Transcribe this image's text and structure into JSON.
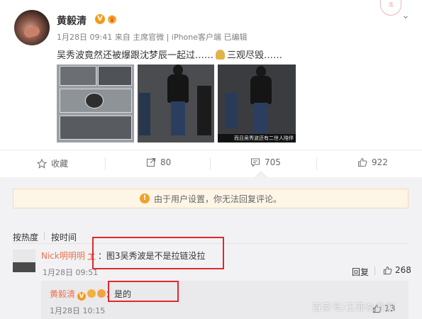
{
  "post": {
    "author": "黄毅清",
    "verified_badge": "V",
    "meta": "1月28日 09:41 来自 主席官微 | iPhone客户端  已编辑",
    "text_before_emoji": "吴秀波竟然还被爆跟沈梦辰一起过……",
    "text_after_emoji": "三观尽毁……",
    "photo_caption": "而且吴秀波还有二世人陪伴",
    "more_icon": "chevron-down-icon",
    "seal_text": "清"
  },
  "actions": {
    "favorite_label": "收藏",
    "forward_count": "80",
    "comment_count": "705",
    "like_count": "922"
  },
  "notice": {
    "text": "由于用户设置，你无法回复评论。"
  },
  "sort": {
    "hot": "按热度",
    "time": "按时间"
  },
  "comment": {
    "user": "Nick明明明",
    "level_icon": "工",
    "text": "：图3吴秀波是不是拉链没拉",
    "time": "1月28日 09:51",
    "reply_label": "回复",
    "like_count": "268"
  },
  "reply": {
    "user": "黄毅清",
    "verified_badge": "V",
    "text": "：是的",
    "time": "1月28日 10:15",
    "like_count": "13"
  },
  "watermark": "百家号/王菲杂看剧",
  "colors": {
    "username": "#eb7350",
    "annotation_box": "#e0282c",
    "notice_bg": "#fdf5e6",
    "comment_bg": "#f2f2f5"
  }
}
